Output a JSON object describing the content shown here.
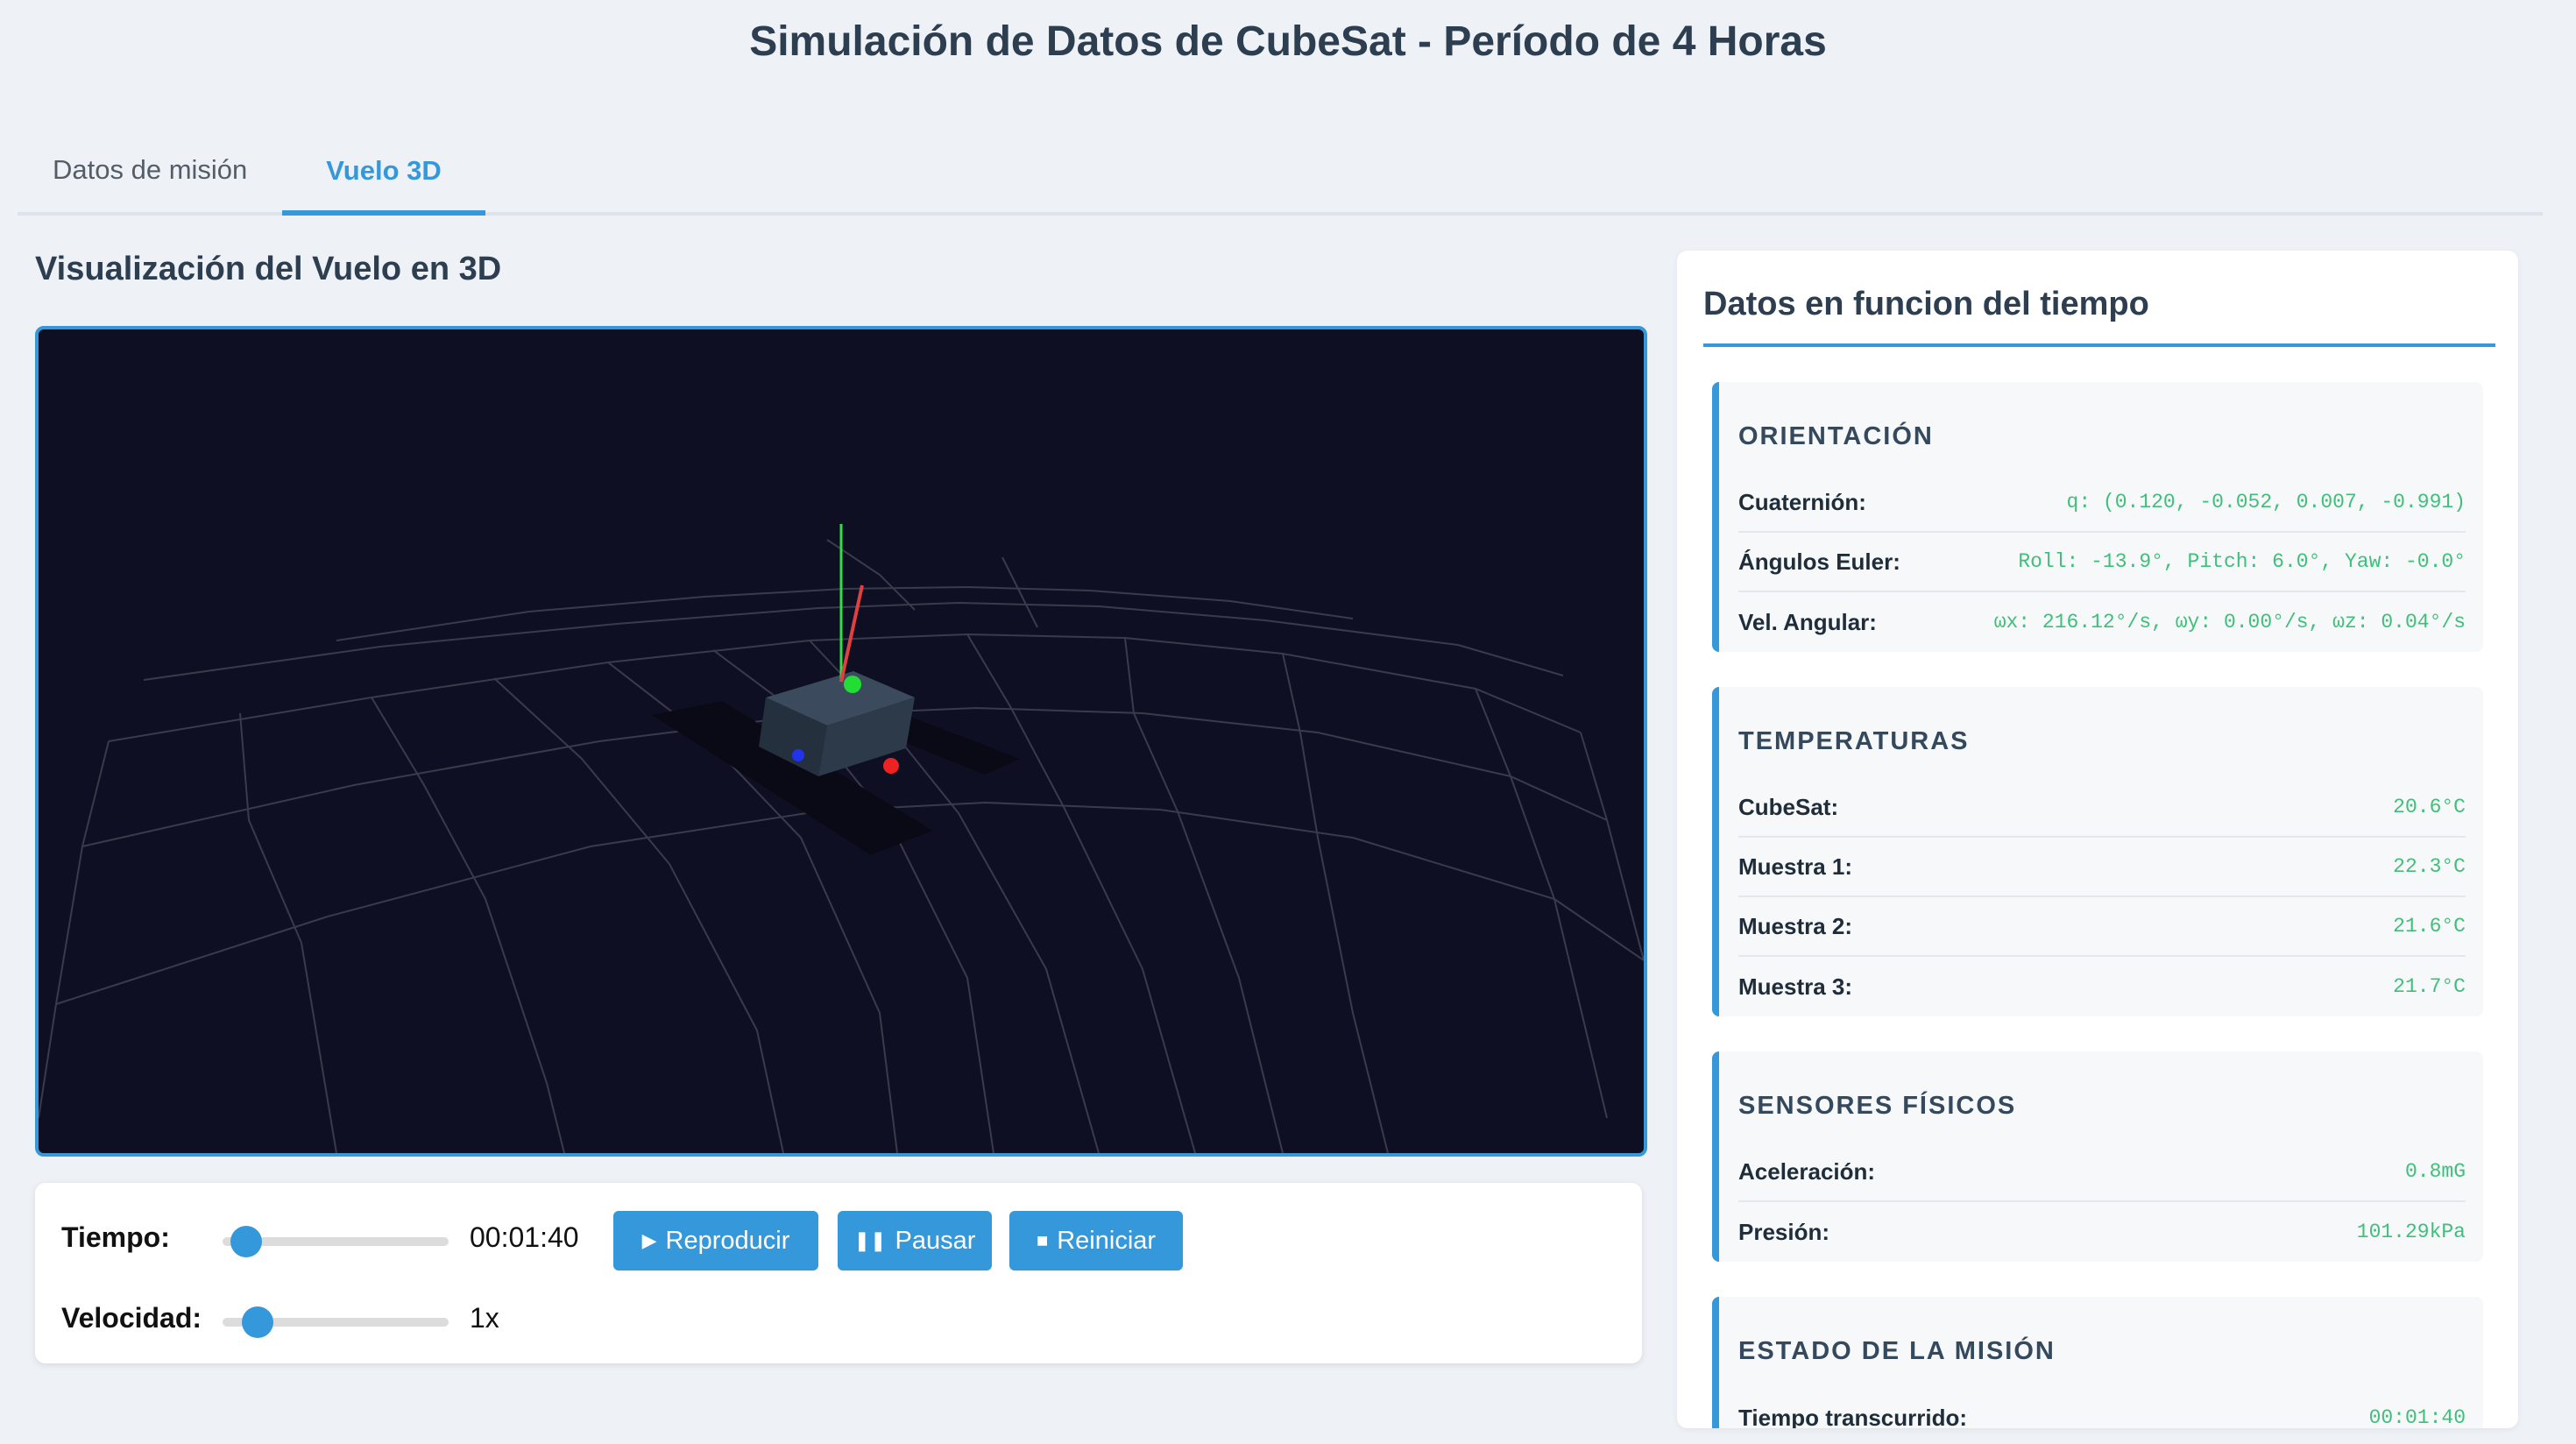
{
  "header": {
    "title": "Simulación de Datos de CubeSat - Período de 4 Horas"
  },
  "tabs": [
    {
      "label": "Datos de misión",
      "active": false
    },
    {
      "label": "Vuelo 3D",
      "active": true
    }
  ],
  "main": {
    "section_title": "Visualización del Vuelo en 3D"
  },
  "controls": {
    "time_label": "Tiempo:",
    "time_value": "00:01:40",
    "time_progress": 0.04,
    "play_label": "Reproducir",
    "pause_label": "Pausar",
    "reset_label": "Reiniciar",
    "speed_label": "Velocidad:",
    "speed_value": "1x",
    "speed_progress": 0.1
  },
  "side": {
    "title": "Datos en funcion del tiempo",
    "orientation": {
      "title": "ORIENTACIÓN",
      "rows": [
        {
          "label": "Cuaternión:",
          "value": "q: (0.120, -0.052, 0.007, -0.991)"
        },
        {
          "label": "Ángulos Euler:",
          "value": "Roll: -13.9°, Pitch: 6.0°, Yaw: -0.0°"
        },
        {
          "label": "Vel. Angular:",
          "value": "ωx: 216.12°/s, ωy: 0.00°/s, ωz: 0.04°/s"
        }
      ]
    },
    "temperatures": {
      "title": "TEMPERATURAS",
      "rows": [
        {
          "label": "CubeSat:",
          "value": "20.6°C"
        },
        {
          "label": "Muestra 1:",
          "value": "22.3°C"
        },
        {
          "label": "Muestra 2:",
          "value": "21.6°C"
        },
        {
          "label": "Muestra 3:",
          "value": "21.7°C"
        }
      ]
    },
    "sensors": {
      "title": "SENSORES FÍSICOS",
      "rows": [
        {
          "label": "Aceleración:",
          "value": "0.8mG"
        },
        {
          "label": "Presión:",
          "value": "101.29kPa"
        }
      ]
    },
    "mission": {
      "title": "ESTADO DE LA MISIÓN",
      "rows": [
        {
          "label": "Tiempo transcurrido:",
          "value": "00:01:40"
        }
      ]
    }
  },
  "colors": {
    "accent": "#3498db",
    "value_green": "#3fbf7a",
    "viewport_bg": "#0e0f22"
  }
}
